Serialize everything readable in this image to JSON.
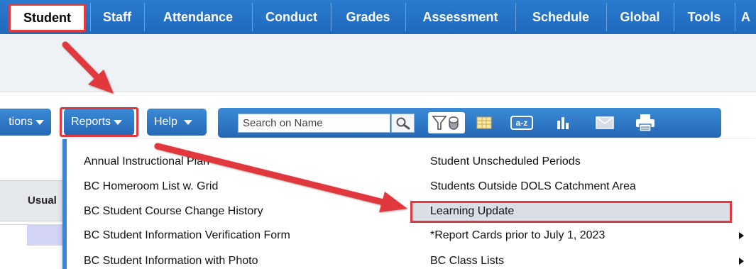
{
  "tabs": [
    {
      "label": "Student",
      "active": true
    },
    {
      "label": "Staff"
    },
    {
      "label": "Attendance"
    },
    {
      "label": "Conduct"
    },
    {
      "label": "Grades"
    },
    {
      "label": "Assessment"
    },
    {
      "label": "Schedule"
    },
    {
      "label": "Global"
    },
    {
      "label": "Tools"
    },
    {
      "label": "A"
    }
  ],
  "toolbar": {
    "options_label": "tions",
    "reports_label": "Reports",
    "help_label": "Help",
    "search_placeholder": "Search on Name",
    "icons": [
      "filter-icon",
      "grid-icon",
      "sort-az-icon",
      "chart-icon",
      "mail-icon",
      "print-icon"
    ],
    "sort_label": "a-z"
  },
  "grid": {
    "header_partial": "Usual"
  },
  "reports_menu": {
    "left_column": [
      "Annual Instructional Plan",
      "BC Homeroom List w. Grid",
      "BC Student Course Change History",
      "BC Student Information Verification Form",
      "BC Student Information with Photo"
    ],
    "right_column": [
      {
        "label": "Student Unscheduled Periods",
        "submenu": false
      },
      {
        "label": "Students Outside DOLS Catchment Area",
        "submenu": false
      },
      {
        "label": "Learning Update",
        "submenu": false,
        "highlighted": true
      },
      {
        "label": "*Report Cards prior to July 1, 2023",
        "submenu": true
      },
      {
        "label": "BC Class Lists",
        "submenu": true
      }
    ]
  },
  "colors": {
    "nav_blue": "#2a7bcf",
    "annotation_red": "#e0393e",
    "highlight_bg": "#d9dee7"
  }
}
